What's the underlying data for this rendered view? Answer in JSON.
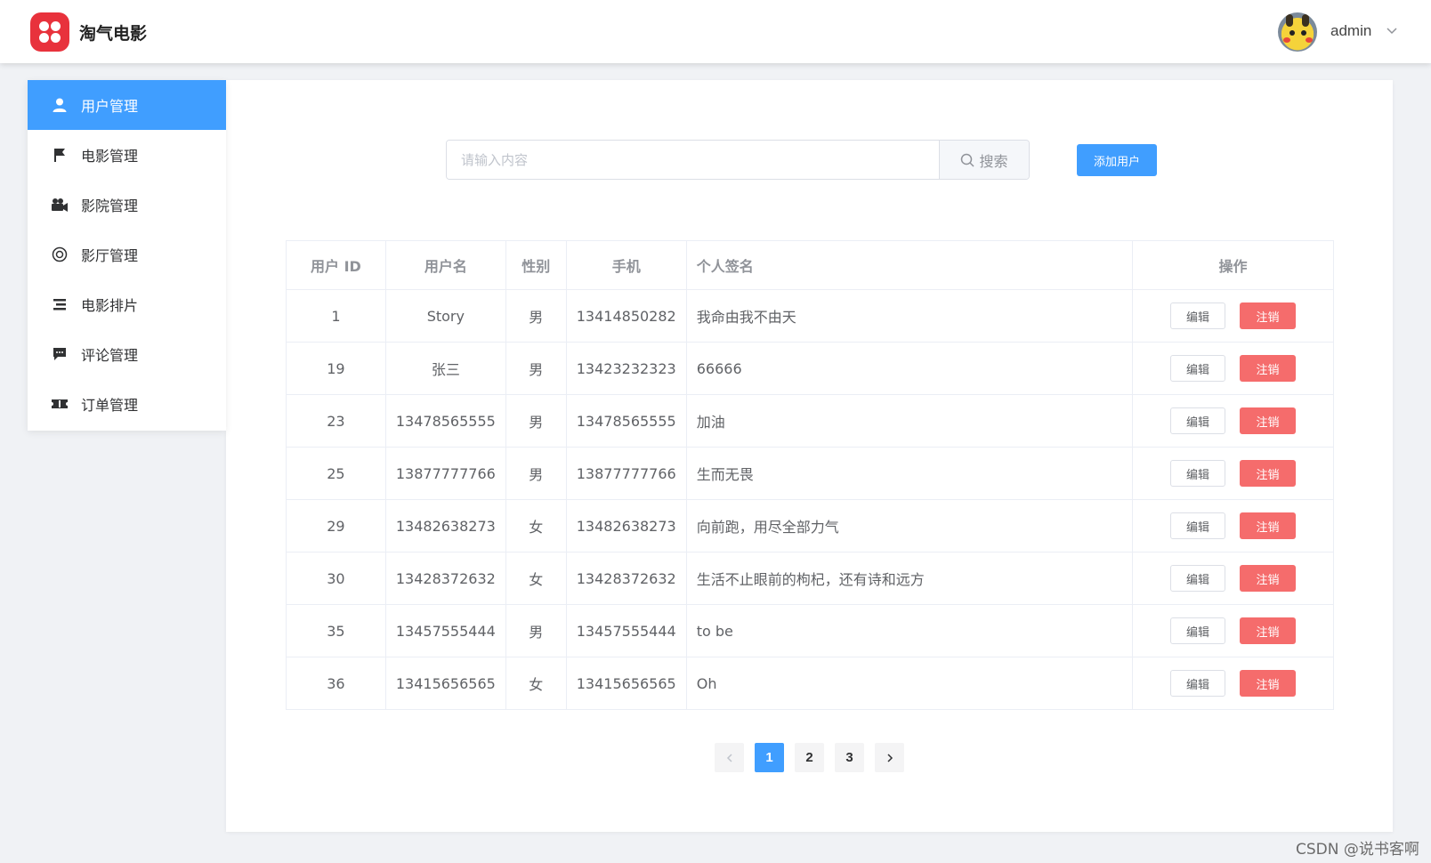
{
  "header": {
    "brand": "淘气电影",
    "username": "admin",
    "icons": {
      "logo": "app-logo",
      "avatar": "pikachu-avatar",
      "caret": "chevron-down-icon"
    }
  },
  "sidebar": {
    "items": [
      {
        "label": "用户管理",
        "icon": "user-icon",
        "active": true
      },
      {
        "label": "电影管理",
        "icon": "flag-icon",
        "active": false
      },
      {
        "label": "影院管理",
        "icon": "video-camera-icon",
        "active": false
      },
      {
        "label": "影厅管理",
        "icon": "help-ring-icon",
        "active": false
      },
      {
        "label": "电影排片",
        "icon": "list-icon",
        "active": false
      },
      {
        "label": "评论管理",
        "icon": "comment-icon",
        "active": false
      },
      {
        "label": "订单管理",
        "icon": "ticket-icon",
        "active": false
      }
    ]
  },
  "toolbar": {
    "search_placeholder": "请输入内容",
    "search_value": "",
    "search_label": "搜索",
    "add_label": "添加用户"
  },
  "table": {
    "columns": [
      "用户 ID",
      "用户名",
      "性别",
      "手机",
      "个人签名",
      "操作"
    ],
    "rows": [
      {
        "id": "1",
        "name": "Story",
        "gender": "男",
        "phone": "13414850282",
        "sign": "我命由我不由天"
      },
      {
        "id": "19",
        "name": "张三",
        "gender": "男",
        "phone": "13423232323",
        "sign": "66666"
      },
      {
        "id": "23",
        "name": "13478565555",
        "gender": "男",
        "phone": "13478565555",
        "sign": "加油"
      },
      {
        "id": "25",
        "name": "13877777766",
        "gender": "男",
        "phone": "13877777766",
        "sign": "生而无畏"
      },
      {
        "id": "29",
        "name": "13482638273",
        "gender": "女",
        "phone": "13482638273",
        "sign": "向前跑，用尽全部力气"
      },
      {
        "id": "30",
        "name": "13428372632",
        "gender": "女",
        "phone": "13428372632",
        "sign": "生活不止眼前的枸杞，还有诗和远方"
      },
      {
        "id": "35",
        "name": "13457555444",
        "gender": "男",
        "phone": "13457555444",
        "sign": "to be"
      },
      {
        "id": "36",
        "name": "13415656565",
        "gender": "女",
        "phone": "13415656565",
        "sign": "Oh"
      }
    ],
    "edit_label": "编辑",
    "cancel_label": "注销"
  },
  "pagination": {
    "pages": [
      "1",
      "2",
      "3"
    ],
    "current": "1"
  },
  "watermark": "CSDN @说书客啊",
  "colors": {
    "primary": "#409eff",
    "danger": "#f56c6c",
    "logo": "#e8323c"
  }
}
